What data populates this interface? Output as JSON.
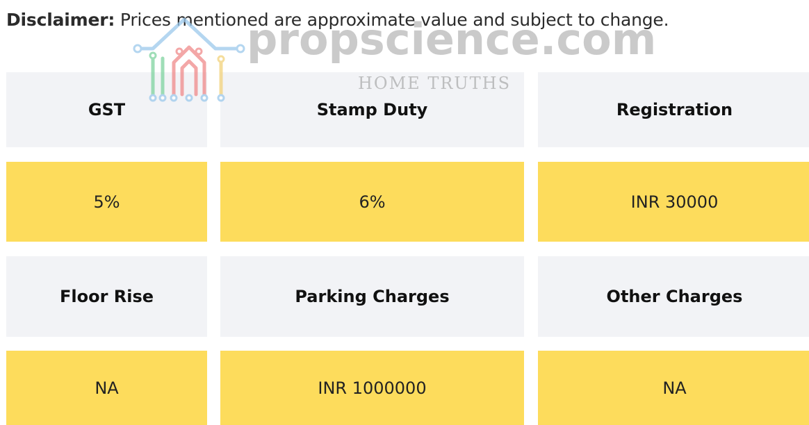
{
  "disclaimer": {
    "label": "Disclaimer:",
    "text": " Prices mentioned are approximate value and subject to change."
  },
  "watermark": {
    "brand": "propscience.com",
    "tagline": "HOME TRUTHS",
    "colors": {
      "green": "#7fd3a0",
      "red": "#f08a8a",
      "yellow": "#f2d27a",
      "blue": "#9cc9ec"
    }
  },
  "table": {
    "header_row_1": [
      "GST",
      "Stamp Duty",
      "Registration"
    ],
    "value_row_1": [
      "5%",
      "6%",
      "INR 30000"
    ],
    "header_row_2": [
      "Floor Rise",
      "Parking Charges",
      "Other Charges"
    ],
    "value_row_2": [
      "NA",
      "INR 1000000",
      "NA"
    ],
    "colors": {
      "header_bg": "#f2f3f6",
      "value_bg": "#fddc5c"
    }
  }
}
